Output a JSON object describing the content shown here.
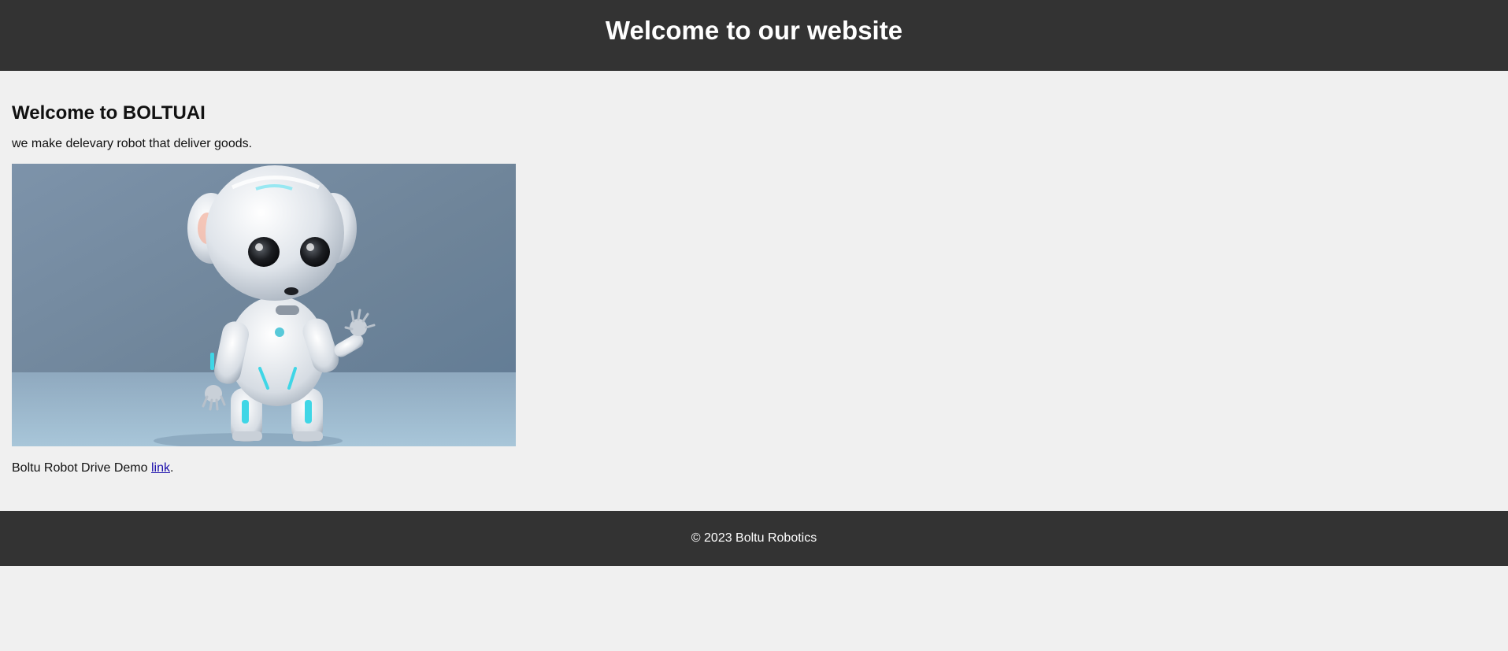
{
  "header": {
    "title": "Welcome to our website"
  },
  "main": {
    "heading": "Welcome to BOLTUAI",
    "tagline": "we make delevary robot that deliver goods.",
    "image_subject": "robot-image",
    "demo_text": "Boltu Robot Drive Demo ",
    "demo_link": "link",
    "demo_suffix": "."
  },
  "footer": {
    "copyright": "© 2023 Boltu Robotics"
  },
  "colors": {
    "header_bg": "#333333",
    "page_bg": "#f0f0f0",
    "link": "#1a0dab"
  }
}
